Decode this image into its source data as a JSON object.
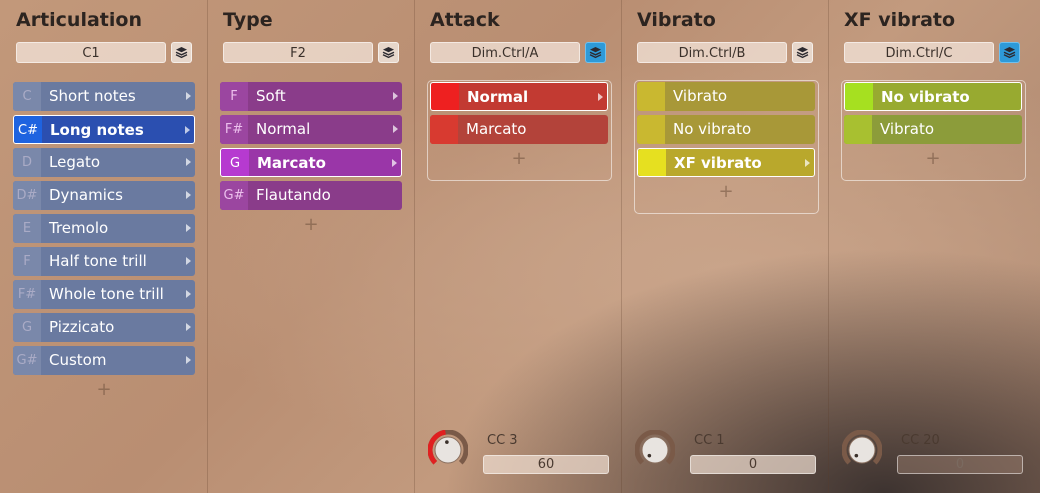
{
  "columns": [
    {
      "id": "articulation",
      "title": "Articulation",
      "field": "C1",
      "layer_active": false,
      "items": [
        {
          "key": "C",
          "label": "Short notes",
          "selected": false
        },
        {
          "key": "C#",
          "label": "Long notes",
          "selected": true
        },
        {
          "key": "D",
          "label": "Legato",
          "selected": false
        },
        {
          "key": "D#",
          "label": "Dynamics",
          "selected": false
        },
        {
          "key": "E",
          "label": "Tremolo",
          "selected": false
        },
        {
          "key": "F",
          "label": "Half tone trill",
          "selected": false
        },
        {
          "key": "F#",
          "label": "Whole tone trill",
          "selected": false
        },
        {
          "key": "G",
          "label": "Pizzicato",
          "selected": false
        },
        {
          "key": "G#",
          "label": "Custom",
          "selected": false
        }
      ],
      "add_label": "+"
    },
    {
      "id": "type",
      "title": "Type",
      "field": "F2",
      "layer_active": false,
      "items": [
        {
          "key": "F",
          "label": "Soft",
          "selected": false,
          "arrow": true
        },
        {
          "key": "F#",
          "label": "Normal",
          "selected": false,
          "arrow": true
        },
        {
          "key": "G",
          "label": "Marcato",
          "selected": true,
          "arrow": true
        },
        {
          "key": "G#",
          "label": "Flautando",
          "selected": false,
          "arrow": false
        }
      ],
      "add_label": "+"
    },
    {
      "id": "attack",
      "title": "Attack",
      "field": "Dim.Ctrl/A",
      "layer_active": true,
      "items": [
        {
          "label": "Normal",
          "selected": true,
          "arrow": true
        },
        {
          "label": "Marcato",
          "selected": false,
          "arrow": false
        }
      ],
      "add_label": "+",
      "cc": {
        "label": "CC 3",
        "value": "60",
        "level": 0.47,
        "dim": false
      }
    },
    {
      "id": "vibrato",
      "title": "Vibrato",
      "field": "Dim.Ctrl/B",
      "layer_active": false,
      "items": [
        {
          "label": "Vibrato",
          "selected": false,
          "arrow": false
        },
        {
          "label": "No vibrato",
          "selected": false,
          "arrow": false
        },
        {
          "label": "XF vibrato",
          "selected": true,
          "arrow": true
        }
      ],
      "add_label": "+",
      "cc": {
        "label": "CC 1",
        "value": "0",
        "level": 0,
        "dim": false
      }
    },
    {
      "id": "xf-vibrato",
      "title": "XF vibrato",
      "field": "Dim.Ctrl/C",
      "layer_active": true,
      "items": [
        {
          "label": "No vibrato",
          "selected": true,
          "arrow": false
        },
        {
          "label": "Vibrato",
          "selected": false,
          "arrow": false
        }
      ],
      "add_label": "+",
      "cc": {
        "label": "CC 20",
        "value": "0",
        "level": 0,
        "dim": true
      }
    }
  ],
  "colors": {
    "articulation_item": "#6a7aa0",
    "articulation_key": "#7a88aa",
    "articulation_selected": "#2b4fb0",
    "articulation_selected_key": "#1e63e0",
    "type_item": "#8a3c8a",
    "type_key": "#9b46a0",
    "type_selected": "#9a36a8",
    "type_selected_key": "#b63ad0",
    "attack_item": "#b3433a",
    "attack_key": "#d83a30",
    "attack_selected": "#c23a32",
    "attack_selected_key": "#ee2020",
    "vibrato_item": "#a89838",
    "vibrato_key": "#c9b830",
    "vibrato_selected": "#b9a82c",
    "vibrato_selected_key": "#e6e020",
    "xf_item": "#8c9c3a",
    "xf_key": "#a8c030",
    "xf_selected": "#98aa30",
    "xf_selected_key": "#a6e020",
    "knob_ring": "#7a5a48",
    "knob_active": "#e02020"
  },
  "icons": {
    "layer": "layers-icon",
    "arrow": "chevron-right-icon",
    "knob": "knob-icon"
  }
}
